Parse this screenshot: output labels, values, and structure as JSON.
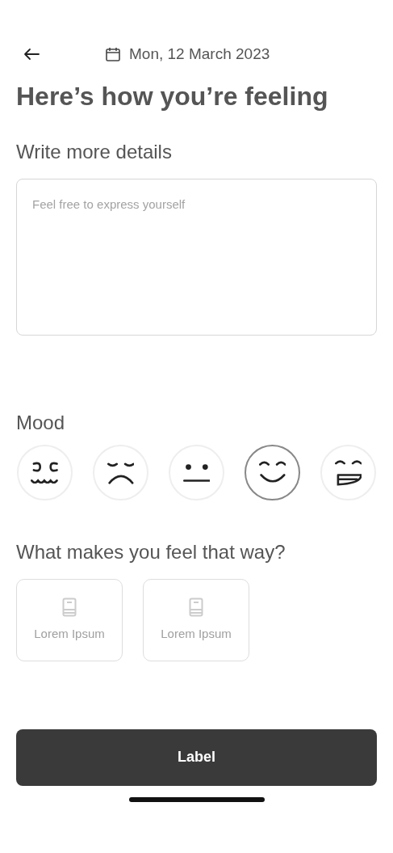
{
  "header": {
    "date": "Mon, 12 March 2023"
  },
  "title": "Here’s how you’re feeling",
  "details": {
    "label": "Write more details",
    "placeholder": "Feel free to express yourself"
  },
  "mood": {
    "label": "Mood",
    "options": [
      {
        "kind": "angry",
        "selected": false
      },
      {
        "kind": "sad",
        "selected": false
      },
      {
        "kind": "neutral",
        "selected": false
      },
      {
        "kind": "happy",
        "selected": true
      },
      {
        "kind": "joyful",
        "selected": false
      }
    ]
  },
  "reasons": {
    "label": "What makes you feel that way?",
    "options": [
      {
        "label": "Lorem Ipsum",
        "selected": false
      },
      {
        "label": "Lorem Ipsum",
        "selected": false
      }
    ]
  },
  "button": {
    "label": "Label"
  }
}
